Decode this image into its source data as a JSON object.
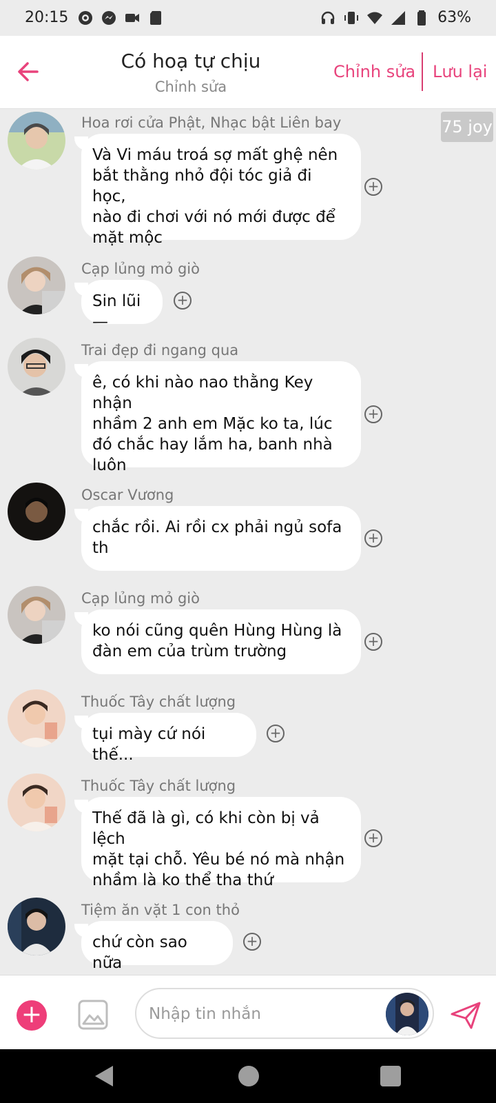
{
  "status_bar": {
    "time": "20:15",
    "battery": "63%"
  },
  "header": {
    "title": "Có hoạ tự chịu",
    "subtitle": "Chỉnh sửa",
    "edit_label": "Chỉnh sửa",
    "save_label": "Lưu lại"
  },
  "joy_badge": "75 joy",
  "messages": [
    {
      "sender": "Hoa rơi cửa Phật, Nhạc bật Liên bay",
      "text": [
        "Và Vi máu troá sợ mất ghệ nên",
        "bắt thằng nhỏ đội tóc giả đi học,",
        "nào đi chơi với nó mới được để",
        "mặt mộc"
      ]
    },
    {
      "sender": "Cạp lủng mỏ giò",
      "text": [
        "Sin lũi—"
      ]
    },
    {
      "sender": "Trai đẹp đi ngang qua",
      "text": [
        "ê, có khi nào nao thằng Key nhận",
        "nhầm 2 anh em Mặc ko ta, lúc",
        "đó chắc hay lắm ha, banh nhà",
        "luôn"
      ]
    },
    {
      "sender": "Oscar Vương",
      "text": [
        "chắc rồi. Ai rồi cx phải ngủ sofa",
        "th"
      ]
    },
    {
      "sender": "Cạp lủng mỏ giò",
      "text": [
        "ko nói cũng quên Hùng Hùng là",
        "đàn em của trùm trường"
      ]
    },
    {
      "sender": "Thuốc Tây chất lượng",
      "text": [
        "tụi mày cứ nói thế..."
      ]
    },
    {
      "sender": "Thuốc Tây chất lượng",
      "text": [
        "Thế đã là gì, có khi còn bị vả lệch",
        "mặt tại chỗ. Yêu bé nó mà nhận",
        "nhầm là ko thể tha thứ"
      ]
    },
    {
      "sender": "Tiệm ăn vặt 1 con thỏ",
      "text": [
        "chứ còn sao nữa"
      ]
    }
  ],
  "composer": {
    "placeholder": "Nhập tin nhắn"
  },
  "colors": {
    "accent": "#e8437c",
    "background": "#ececec",
    "bubble": "#ffffff"
  }
}
